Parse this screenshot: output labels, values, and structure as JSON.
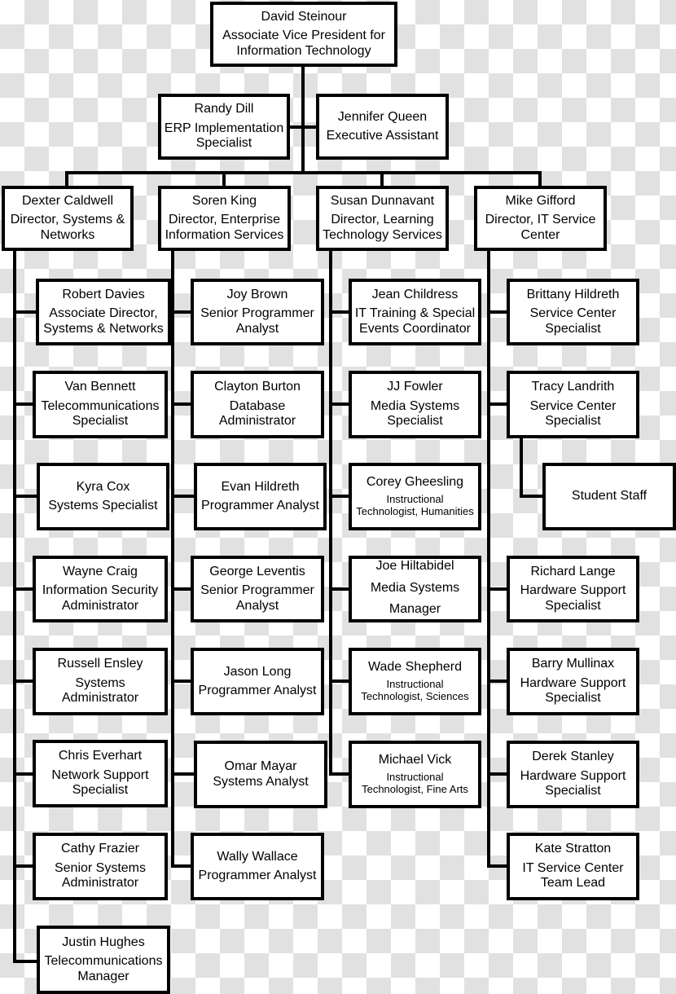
{
  "chart": {
    "top": {
      "name": "David Steinour",
      "title": "Associate Vice President for\nInformation Technology"
    },
    "staff": [
      {
        "name": "Randy Dill",
        "title": "ERP Implementation\nSpecialist"
      },
      {
        "name": "Jennifer Queen",
        "title": "Executive Assistant"
      }
    ],
    "directors": [
      {
        "name": "Dexter Caldwell",
        "title": "Director, Systems &\nNetworks",
        "reports": [
          {
            "name": "Robert Davies",
            "title": "Associate Director,\nSystems & Networks"
          },
          {
            "name": "Van Bennett",
            "title": "Telecommunications\nSpecialist"
          },
          {
            "name": "Kyra Cox",
            "title": "Systems Specialist"
          },
          {
            "name": "Wayne Craig",
            "title": "Information Security\nAdministrator"
          },
          {
            "name": "Russell Ensley",
            "title": "Systems\nAdministrator"
          },
          {
            "name": "Chris Everhart",
            "title": "Network Support\nSpecialist"
          },
          {
            "name": "Cathy Frazier",
            "title": "Senior Systems\nAdministrator"
          },
          {
            "name": "Justin Hughes",
            "title": "Telecommunications\nManager"
          }
        ]
      },
      {
        "name": "Soren King",
        "title": "Director, Enterprise\nInformation Services",
        "reports": [
          {
            "name": "Joy Brown",
            "title": "Senior Programmer\nAnalyst"
          },
          {
            "name": "Clayton Burton",
            "title": "Database\nAdministrator"
          },
          {
            "name": "Evan Hildreth",
            "title": "Programmer Analyst"
          },
          {
            "name": "George Leventis",
            "title": "Senior Programmer\nAnalyst"
          },
          {
            "name": "Jason Long",
            "title": "Programmer Analyst"
          },
          {
            "name": "Omar Mayar",
            "title": "Systems Analyst"
          },
          {
            "name": "Wally Wallace",
            "title": "Programmer Analyst"
          }
        ]
      },
      {
        "name": "Susan Dunnavant",
        "title": "Director, Learning\nTechnology Services",
        "reports": [
          {
            "name": "Jean Childress",
            "title": "IT Training & Special\nEvents Coordinator"
          },
          {
            "name": "JJ Fowler",
            "title": "Media Systems\nSpecialist"
          },
          {
            "name": "Corey Gheesling",
            "title": "Instructional\nTechnologist, Humanities"
          },
          {
            "name": "Joe Hiltabidel",
            "title": "Media Systems\nManager"
          },
          {
            "name": "Wade Shepherd",
            "title": "Instructional\nTechnologist, Sciences"
          },
          {
            "name": "Michael Vick",
            "title": "Instructional\nTechnologist, Fine Arts"
          }
        ]
      },
      {
        "name": "Mike Gifford",
        "title": "Director, IT Service\nCenter",
        "reports": [
          {
            "name": "Brittany Hildreth",
            "title": "Service Center\nSpecialist"
          },
          {
            "name": "Tracy Landrith",
            "title": "Service Center\nSpecialist"
          },
          {
            "name": "Richard Lange",
            "title": "Hardware Support\nSpecialist"
          },
          {
            "name": "Barry Mullinax",
            "title": "Hardware Support\nSpecialist"
          },
          {
            "name": "Derek Stanley",
            "title": "Hardware Support\nSpecialist"
          },
          {
            "name": "Kate Stratton",
            "title": "IT Service Center\nTeam Lead"
          }
        ]
      }
    ],
    "sub_unit": {
      "label": "Student Staff",
      "reports_to": "Tracy Landrith"
    }
  }
}
